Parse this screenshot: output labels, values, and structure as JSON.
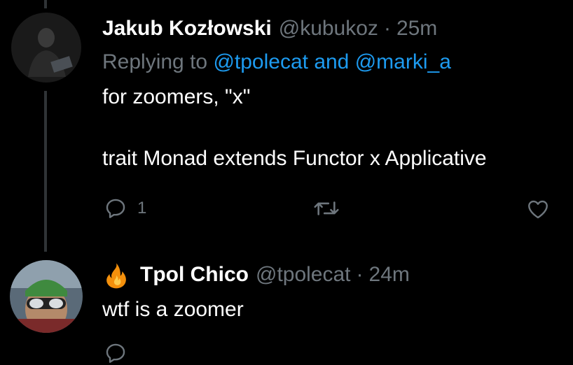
{
  "tweets": [
    {
      "name": "Jakub Kozłowski",
      "handle": "@kubukoz",
      "separator": "·",
      "time": "25m",
      "replying_prefix": "Replying to",
      "replying_to_1": "@tpolecat",
      "replying_and": "and",
      "replying_to_2": "@marki_a",
      "text_line_1": "for zoomers, \"x\"",
      "text_line_2": "trait Monad extends Functor x Applicative",
      "actions": {
        "reply_count": "1"
      }
    },
    {
      "name": "Tpol Chico",
      "handle": "@tpolecat",
      "separator": "·",
      "time": "24m",
      "name_emoji": "fire",
      "text_line_1": "wtf is a zoomer"
    }
  ],
  "colors": {
    "background": "#000000",
    "text": "#ffffff",
    "secondary": "#6e767d",
    "link": "#1d9bf0",
    "thread_line": "#2f3336"
  },
  "icons": [
    "reply-icon",
    "retweet-icon",
    "like-icon",
    "fire-icon"
  ]
}
